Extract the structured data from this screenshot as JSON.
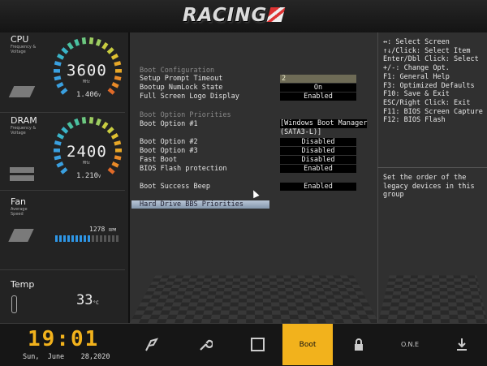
{
  "header": {
    "logo": "RACING"
  },
  "sidebar": {
    "cpu": {
      "title": "CPU",
      "subtitle": "Frequency & Voltage",
      "value": "3600",
      "unit": "MHz",
      "voltage": "1.406",
      "unit_v": "V"
    },
    "dram": {
      "title": "DRAM",
      "subtitle": "Frequency & Voltage",
      "value": "2400",
      "unit": "MHz",
      "voltage": "1.210",
      "unit_v": "V"
    },
    "fan": {
      "title": "Fan",
      "subtitle": "Average Speed",
      "value": "1278",
      "unit": "RPM",
      "level": 0.55
    },
    "temp": {
      "title": "Temp",
      "value": "33",
      "unit": "°C"
    }
  },
  "main": {
    "section_boot_config": "Boot Configuration",
    "setup_prompt_label": "Setup Prompt Timeout",
    "setup_prompt_value": "2",
    "numlock_label": "Bootup NumLock State",
    "numlock_value": "On",
    "logo_label": "Full Screen Logo Display",
    "logo_value": "Enabled",
    "section_priorities": "Boot Option Priorities",
    "opt1_label": "Boot Option #1",
    "opt1_value_line1": "[Windows Boot Manager",
    "opt1_value_line2": "(SATA3-L)]",
    "opt2_label": "Boot Option #2",
    "opt2_value": "Disabled",
    "opt3_label": "Boot Option #3",
    "opt3_value": "Disabled",
    "fastboot_label": "Fast Boot",
    "fastboot_value": "Disabled",
    "flashprot_label": "BIOS Flash protection",
    "flashprot_value": "Enabled",
    "beep_label": "Boot Success Beep",
    "beep_value": "Enabled",
    "hdd_label": "Hard Drive BBS Priorities"
  },
  "help": {
    "keys": "↔: Select Screen\n↑↓/Click: Select Item\nEnter/Dbl Click: Select\n+/-: Change Opt.\nF1: General Help\nF3: Optimized Defaults\nF10: Save & Exit\nESC/Right Click: Exit\nF11: BIOS Screen Capture\nF12: BIOS Flash",
    "description": "Set the order of the\nlegacy devices in this\ngroup"
  },
  "footer": {
    "time": "19:01",
    "date": "Sun,  June    28,2020",
    "tabs": {
      "boot": "Boot",
      "one": "O.N.E"
    },
    "accent": "#f2b21c"
  }
}
